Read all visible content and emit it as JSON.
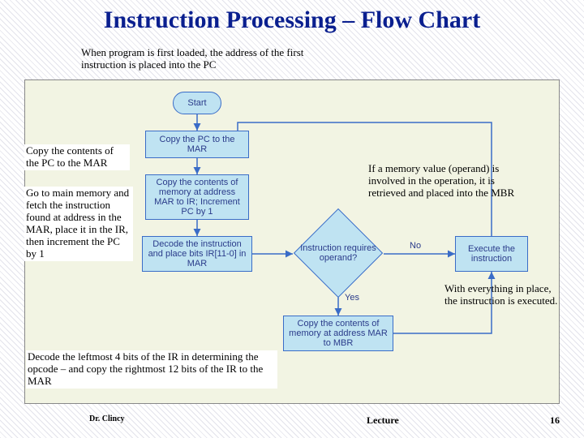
{
  "title": "Instruction Processing – Flow Chart",
  "intro": "When program is first loaded, the address of the first instruction is placed into the PC",
  "annotations": {
    "copy_pc": "Copy the contents of the PC to the MAR",
    "fetch": "Go to main memory and fetch the instruction found at address in the MAR, place it in the IR, then increment the PC by 1",
    "decode": "Decode the leftmost 4 bits of the IR in determining the opcode – and copy the rightmost 12 bits of the IR to the MAR",
    "operand": "If a memory value (operand) is involved in the operation, it is retrieved and placed into the MBR",
    "execute": "With everything in place, the instruction is executed."
  },
  "flow": {
    "start": "Start",
    "copy_pc_mar": "Copy the PC to the MAR",
    "copy_mem_ir": "Copy the contents of memory at address MAR to IR; Increment PC by 1",
    "decode_ir": "Decode the instruction and place bits IR[11-0] in MAR",
    "decision": "Instruction requires operand?",
    "yes": "Yes",
    "no": "No",
    "copy_mem_mbr": "Copy the contents of memory at address MAR to MBR",
    "execute": "Execute the instruction"
  },
  "footer": {
    "author": "Dr. Clincy",
    "lecture": "Lecture",
    "page": "16"
  }
}
